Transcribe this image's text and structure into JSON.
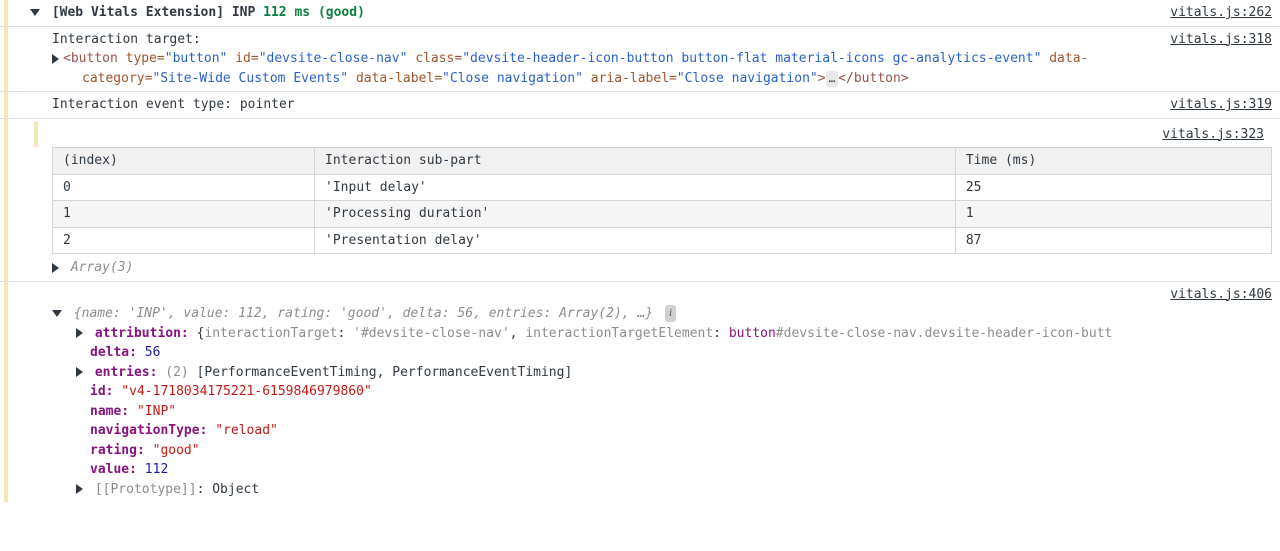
{
  "row1": {
    "title": "[Web Vitals Extension] INP",
    "value": "112 ms (good)",
    "source": "vitals.js:262"
  },
  "row2": {
    "label": "Interaction target:",
    "source": "vitals.js:318",
    "html": {
      "open1": "<button",
      "attr_type_n": " type=",
      "attr_type_v": "\"button\"",
      "attr_id_n": " id=",
      "attr_id_v": "\"devsite-close-nav\"",
      "attr_class_n": " class=",
      "attr_class_v": "\"devsite-header-icon-button button-flat material-icons gc-analytics-event\"",
      "attr_data_n": " data-",
      "attr_cat_n": "category=",
      "attr_cat_v": "\"Site-Wide Custom Events\"",
      "attr_dl_n": " data-label=",
      "attr_dl_v": "\"Close navigation\"",
      "attr_al_n": " aria-label=",
      "attr_al_v": "\"Close navigation\"",
      "close1": ">",
      "ellipsis": "…",
      "close2": "</button>"
    }
  },
  "row3": {
    "text": "Interaction event type: pointer",
    "source": "vitals.js:319"
  },
  "row4": {
    "source": "vitals.js:323",
    "table": {
      "h1": "(index)",
      "h2": "Interaction sub-part",
      "h3": "Time (ms)",
      "rows": [
        {
          "i": "0",
          "sub": "'Input delay'",
          "t": "25"
        },
        {
          "i": "1",
          "sub": "'Processing duration'",
          "t": "1"
        },
        {
          "i": "2",
          "sub": "'Presentation delay'",
          "t": "87"
        }
      ]
    },
    "array_label": "Array(3)"
  },
  "row5": {
    "source": "vitals.js:406",
    "summary": {
      "open": "{",
      "p1k": "name:",
      "p1v": " 'INP'",
      "sep": ", ",
      "p2k": "value:",
      "p2v": " 112",
      "p3k": "rating:",
      "p3v": " 'good'",
      "p4k": "delta:",
      "p4v": " 56",
      "p5k": "entries:",
      "p5v": " Array(2)",
      "more": ", …",
      "close": "}"
    },
    "attribution": {
      "key": "attribution:",
      "open": " {",
      "p1k": "interactionTarget",
      "p1c": ": ",
      "p1v": "'#devsite-close-nav'",
      "sep": ", ",
      "p2k": "interactionTargetElement",
      "p2c": ": ",
      "p2v1": "button",
      "p2v2": "#devsite-close-nav.devsite-header-icon-butt"
    },
    "delta": {
      "key": "delta:",
      "val": " 56"
    },
    "entries": {
      "key": "entries:",
      "count": " (2)",
      "val": " [PerformanceEventTiming, PerformanceEventTiming]"
    },
    "id": {
      "key": "id:",
      "val": " \"v4-1718034175221-6159846979860\""
    },
    "name": {
      "key": "name:",
      "val": " \"INP\""
    },
    "navtype": {
      "key": "navigationType:",
      "val": " \"reload\""
    },
    "rating": {
      "key": "rating:",
      "val": " \"good\""
    },
    "value": {
      "key": "value:",
      "val": " 112"
    },
    "proto": {
      "key": "[[Prototype]]",
      "colon": ": ",
      "val": "Object"
    }
  }
}
